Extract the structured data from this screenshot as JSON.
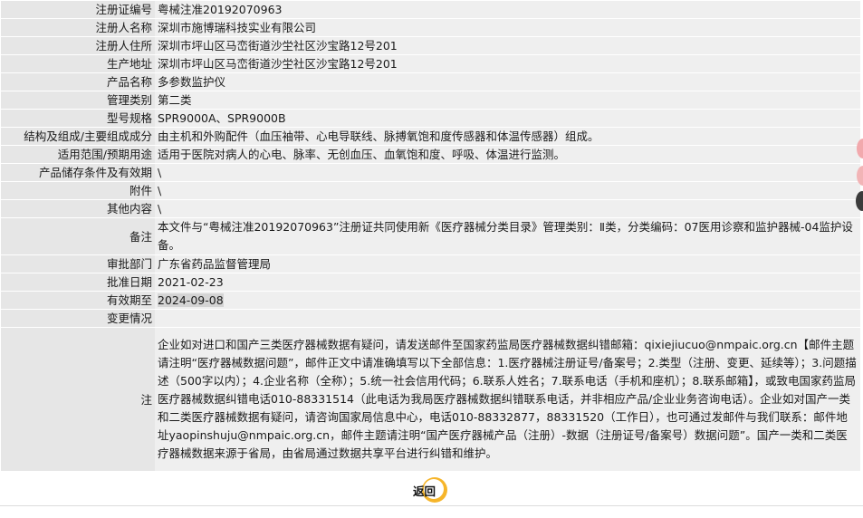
{
  "rows": [
    {
      "label": "注册证编号",
      "value": "粤械注准20192070963"
    },
    {
      "label": "注册人名称",
      "value": "深圳市施博瑞科技实业有限公司"
    },
    {
      "label": "注册人住所",
      "value": "深圳市坪山区马峦街道沙坣社区沙宝路12号201"
    },
    {
      "label": "生产地址",
      "value": "深圳市坪山区马峦街道沙坣社区沙宝路12号201"
    },
    {
      "label": "产品名称",
      "value": "多参数监护仪"
    },
    {
      "label": "管理类别",
      "value": "第二类"
    },
    {
      "label": "型号规格",
      "value": "SPR9000A、SPR9000B"
    },
    {
      "label": "结构及组成/主要组成成分",
      "value": "由主机和外购配件（血压袖带、心电导联线、脉搏氧饱和度传感器和体温传感器）组成。"
    },
    {
      "label": "适用范围/预期用途",
      "value": "适用于医院对病人的心电、脉率、无创血压、血氧饱和度、呼吸、体温进行监测。"
    },
    {
      "label": "产品储存条件及有效期",
      "value": "\\"
    },
    {
      "label": "附件",
      "value": "\\"
    },
    {
      "label": "其他内容",
      "value": "\\"
    },
    {
      "label": "备注",
      "value": "本文件与“粤械注准20192070963”注册证共同使用新《医疗器械分类目录》管理类别：Ⅱ类，分类编码：07医用诊察和监护器械-04监护设备。"
    },
    {
      "label": "审批部门",
      "value": "广东省药品监督管理局"
    },
    {
      "label": "批准日期",
      "value": "2021-02-23"
    },
    {
      "label": "有效期至",
      "value": "2024-09-08"
    },
    {
      "label": "变更情况",
      "value": ""
    }
  ],
  "note": {
    "label": "注",
    "text": "企业如对进口和国产三类医疗器械数据有疑问，请发送邮件至国家药监局医疗器械数据纠错邮箱：qixiejiucuo@nmpaic.org.cn【邮件主题请注明“医疗器械数据问题”，邮件正文中请准确填写以下全部信息：1.医疗器械注册证号/备案号；2.类型（注册、变更、延续等）；3.问题描述（500字以内）；4.企业名称（全称）；5.统一社会信用代码；6.联系人姓名；7.联系电话（手机和座机）；8.联系邮箱】，或致电国家药监局医疗器械数据纠错电话010-88331514（此电话为我局医疗器械数据纠错联系电话，并非相应产品/企业业务咨询电话）。企业如对国产一类和二类医疗器械数据有疑问，请咨询国家局信息中心，电话010-88332877，88331520（工作日），也可通过发邮件与我们联系：邮件地址yaopinshuju@nmpaic.org.cn，邮件主题请注明“国产医疗器械产品（注册）-数据（注册证号/备案号）数据问题”。国产一类和二类医疗器械数据来源于省局，由省局通过数据共享平台进行纠错和维护。"
  },
  "back_button": {
    "label": "返回"
  },
  "colors": {
    "label_bg": "#e6e6e6",
    "value_bg": "#efefef",
    "accent": "#f6b52a"
  }
}
